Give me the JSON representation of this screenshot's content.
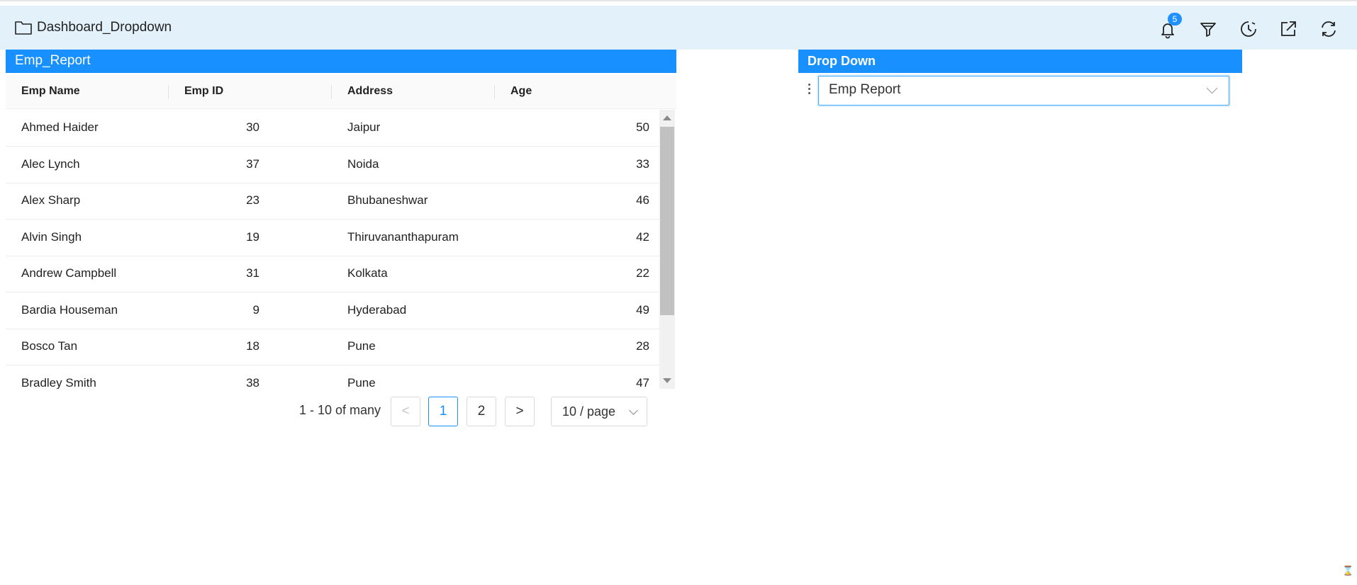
{
  "header": {
    "title": "Dashboard_Dropdown",
    "notification_count": "5",
    "icons": [
      "folder-icon",
      "bell-icon",
      "filter-icon",
      "clock-icon",
      "export-icon",
      "refresh-icon"
    ]
  },
  "emp_report": {
    "title": "Emp_Report",
    "columns": [
      "Emp Name",
      "Emp ID",
      "Address",
      "Age"
    ],
    "rows": [
      {
        "name": "Ahmed Haider",
        "id": "30",
        "address": "Jaipur",
        "age": "50"
      },
      {
        "name": "Alec Lynch",
        "id": "37",
        "address": "Noida",
        "age": "33"
      },
      {
        "name": "Alex Sharp",
        "id": "23",
        "address": "Bhubaneshwar",
        "age": "46"
      },
      {
        "name": "Alvin Singh",
        "id": "19",
        "address": "Thiruvananthapuram",
        "age": "42"
      },
      {
        "name": "Andrew Campbell",
        "id": "31",
        "address": "Kolkata",
        "age": "22"
      },
      {
        "name": "Bardia Houseman",
        "id": "9",
        "address": "Hyderabad",
        "age": "49"
      },
      {
        "name": "Bosco Tan",
        "id": "18",
        "address": "Pune",
        "age": "28"
      },
      {
        "name": "Bradley Smith",
        "id": "38",
        "address": "Pune",
        "age": "47"
      }
    ],
    "pagination": {
      "summary": "1 - 10 of many",
      "prev": "<",
      "pages": [
        "1",
        "2"
      ],
      "current_page": "1",
      "next": ">",
      "page_size": "10 / page"
    }
  },
  "dropdown_widget": {
    "title": "Drop Down",
    "selected_value": "Emp Report"
  },
  "colors": {
    "header_bg": "#e3f1fa",
    "accent": "#1890ff"
  }
}
